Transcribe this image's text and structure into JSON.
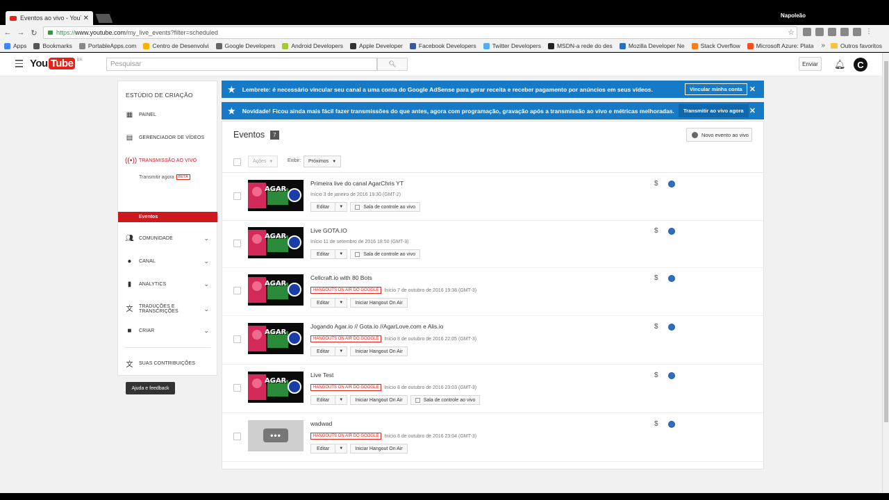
{
  "browser": {
    "tab_title": "Eventos ao vivo - YouTube",
    "user": "Napoleão",
    "url_prefix": "https://",
    "url_host": "www.youtube.com",
    "url_path": "/my_live_events?filter=scheduled",
    "bookmarks": [
      {
        "label": "Apps",
        "color": "#4285f4"
      },
      {
        "label": "Bookmarks",
        "color": "#555555"
      },
      {
        "label": "PortableApps.com",
        "color": "#888888"
      },
      {
        "label": "Centro de Desenvolvi",
        "color": "#f4b400"
      },
      {
        "label": "Google Developers",
        "color": "#666666"
      },
      {
        "label": "Android Developers",
        "color": "#a4c639"
      },
      {
        "label": "Apple Developer",
        "color": "#333333"
      },
      {
        "label": "Facebook Developers",
        "color": "#3b5998"
      },
      {
        "label": "Twitter Developers",
        "color": "#55acee"
      },
      {
        "label": "MSDN-a rede do des",
        "color": "#222222"
      },
      {
        "label": "Mozilla Developer Ne",
        "color": "#2a6ebb"
      },
      {
        "label": "Stack Overflow",
        "color": "#f48024"
      },
      {
        "label": "Microsoft Azure: Plata",
        "color": "#f25022"
      }
    ],
    "other_bookmarks": "Outros favoritos"
  },
  "masthead": {
    "logo_you": "You",
    "logo_tube": "Tube",
    "logo_region": "BR",
    "search_placeholder": "Pesquisar",
    "upload_label": "Enviar",
    "avatar_letter": "C"
  },
  "sidebar": {
    "title": "ESTÚDIO DE CRIAÇÃO",
    "items": [
      {
        "label": "PAINEL",
        "icon": "dashboard-icon"
      },
      {
        "label": "GERENCIADOR DE VÍDEOS",
        "icon": "video-manager-icon"
      },
      {
        "label": "TRANSMISSÃO AO VIVO",
        "icon": "live-broadcast-icon"
      },
      {
        "label": "COMUNIDADE",
        "icon": "community-icon"
      },
      {
        "label": "CANAL",
        "icon": "channel-icon"
      },
      {
        "label": "ANALYTICS",
        "icon": "analytics-icon"
      },
      {
        "label": "TRADUÇÕES E TRANSCRIÇÕES",
        "icon": "translate-icon"
      },
      {
        "label": "CRIAR",
        "icon": "camera-icon"
      },
      {
        "label": "SUAS CONTRIBUIÇÕES",
        "icon": "contributions-icon"
      }
    ],
    "sub_stream_now": "Transmitir agora",
    "sub_beta": "BETA",
    "sub_events": "Eventos",
    "help_button": "Ajuda e feedback"
  },
  "banners": {
    "adsense_text": "Lembrete: é necessário vincular seu canal a uma conta do Google AdSense para gerar receita e receber pagamento por anúncios em seus vídeos.",
    "adsense_button": "Vincular minha conta",
    "news_text": "Novidade! Ficou ainda mais fácil fazer transmissões do que antes, agora com programação, gravação após a transmissão ao vivo e métricas melhoradas.",
    "news_button": "Transmitir ao vivo agora",
    "color": "#167ac6"
  },
  "events": {
    "title": "Eventos",
    "count": "7",
    "new_event_button": "Novo evento ao vivo",
    "actions_label": "Ações",
    "show_label": "Exibir:",
    "show_value": "Próximos",
    "edit_label": "Editar",
    "control_room_label": "Sala de controle ao vivo",
    "hangout_label": "Iniciar Hangout On Air",
    "hoa_badge": "HANGOUTS ON AIR DO GOOGLE",
    "rows": [
      {
        "name": "Primeira live do canal AgarChris YT",
        "date": "Início 3 de janeiro de 2016 19:30 (GMT-2)"
      },
      {
        "name": "Live GOTA.IO",
        "date": "Início 11 de setembro de 2016 18:50 (GMT-3)"
      },
      {
        "name": "Cellcraft.io with 80 Bots",
        "date": "Início 7 de outubro de 2016 19:38 (GMT-3)"
      },
      {
        "name": "Jogando Agar.io // Gota.io //AgarLove.com e Alis.io",
        "date": "Início 8 de outubro de 2016 22:05 (GMT-3)"
      },
      {
        "name": "Live Test",
        "date": "Início 8 de outubro de 2016 23:03 (GMT-3)"
      },
      {
        "name": "wadwad",
        "date": "Início 8 de outubro de 2016 23:04 (GMT-3)"
      }
    ],
    "thumb_text": "AGAR"
  }
}
